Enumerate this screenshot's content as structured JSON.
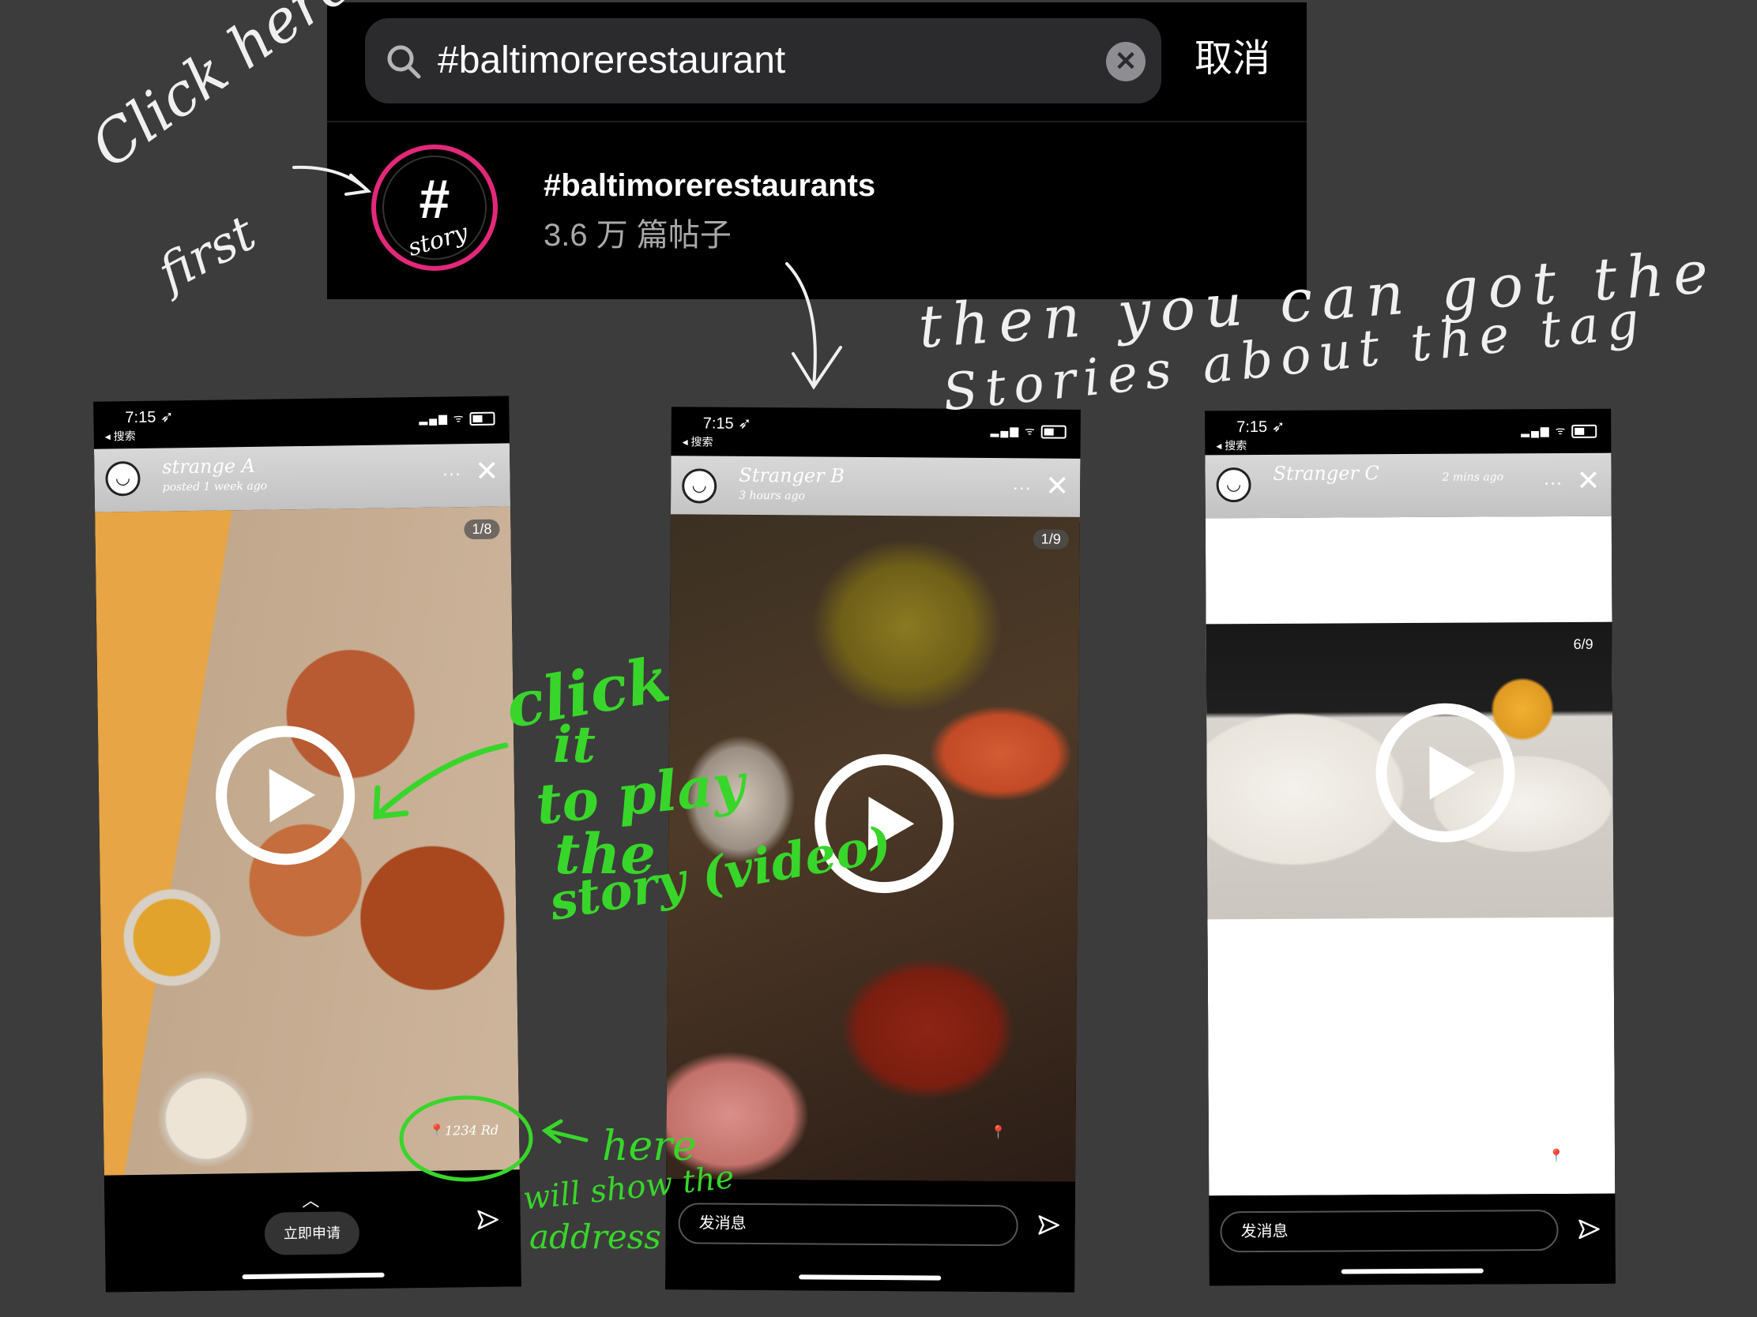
{
  "search": {
    "query": "#baltimorerestaurant",
    "cancel_label": "取消",
    "result": {
      "badge_hash": "#",
      "badge_text": "story",
      "tag_name": "#baltimorerestaurants",
      "post_count": "3.6 万 篇帖子"
    }
  },
  "phones": [
    {
      "time": "7:15 ➶",
      "back_label": "◂ 搜索",
      "user": "strange A",
      "ago": "posted 1 week ago",
      "page": "1/8",
      "location": "1234 Rd",
      "apply_label": "立即申请"
    },
    {
      "time": "7:15 ➶",
      "back_label": "◂ 搜索",
      "user": "Stranger B",
      "ago": "3 hours ago",
      "page": "1/9",
      "message_placeholder": "发消息"
    },
    {
      "time": "7:15 ➶",
      "back_label": "◂ 搜索",
      "user": "Stranger C",
      "ago": "2 mins ago",
      "page": "6/9",
      "message_placeholder": "发消息"
    }
  ],
  "annotations": {
    "click_here_1": "Click here",
    "click_here_2": "first",
    "then_1": "then you can got the",
    "then_2": "Stories about the tag",
    "click_it_1": "click",
    "click_it_2": "it",
    "click_it_3": "to play",
    "click_it_4": "the",
    "click_it_5": "story (video)",
    "here_1": "here",
    "here_2": "will show the",
    "here_3": "address"
  },
  "colors": {
    "ring": "#e3287a",
    "annotation_green": "#38d62a",
    "background": "#3c3c3c"
  }
}
